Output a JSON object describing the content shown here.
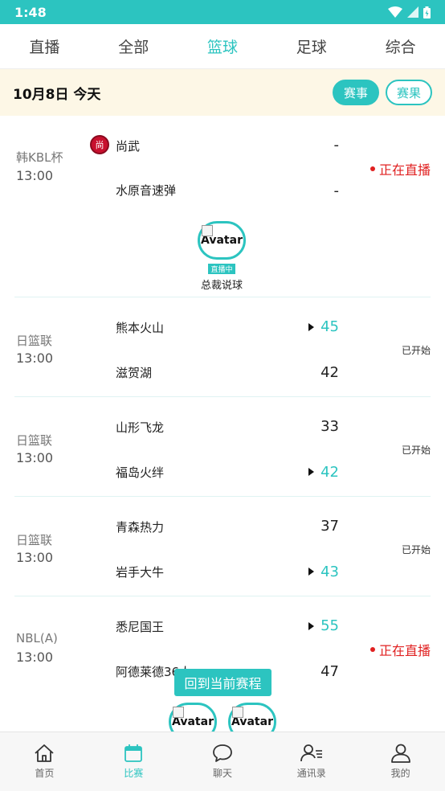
{
  "status_bar": {
    "time": "1:48"
  },
  "tabs": [
    {
      "label": "直播"
    },
    {
      "label": "全部"
    },
    {
      "label": "篮球",
      "active": true
    },
    {
      "label": "足球"
    },
    {
      "label": "综合"
    }
  ],
  "date_bar": {
    "date": "10月8日 今天",
    "btn_events": "赛事",
    "btn_results": "赛果"
  },
  "matches": [
    {
      "league": "韩KBL杯",
      "time": "13:00",
      "home": "尚武",
      "away": "水原音速弹",
      "home_score": "-",
      "away_score": "-",
      "status": "正在直播",
      "badge": "尚"
    },
    {
      "league": "日篮联",
      "time": "13:00",
      "home": "熊本火山",
      "away": "滋贺湖",
      "home_score": "45",
      "away_score": "42",
      "status": "已开始"
    },
    {
      "league": "日篮联",
      "time": "13:00",
      "home": "山形飞龙",
      "away": "福岛火绊",
      "home_score": "33",
      "away_score": "42",
      "status": "已开始"
    },
    {
      "league": "日篮联",
      "time": "13:00",
      "home": "青森热力",
      "away": "岩手大牛",
      "home_score": "37",
      "away_score": "43",
      "status": "已开始"
    },
    {
      "league": "NBL(A)",
      "time": "13:00",
      "home": "悉尼国王",
      "away": "阿德莱德36人",
      "home_score": "55",
      "away_score": "47",
      "status": "正在直播"
    }
  ],
  "anchor": {
    "alt": "Avatar",
    "live_tag": "直播中",
    "name": "总裁说球"
  },
  "toast": "回到当前赛程",
  "bottom_nav": [
    {
      "label": "首页",
      "icon": "home-icon"
    },
    {
      "label": "比赛",
      "icon": "calendar-icon",
      "active": true
    },
    {
      "label": "聊天",
      "icon": "chat-bubble-icon"
    },
    {
      "label": "通讯录",
      "icon": "contacts-icon"
    },
    {
      "label": "我的",
      "icon": "person-icon"
    }
  ],
  "colors": {
    "accent": "#2cc4c0",
    "live_red": "#e02020",
    "date_bar_bg": "#fdf7e6"
  }
}
